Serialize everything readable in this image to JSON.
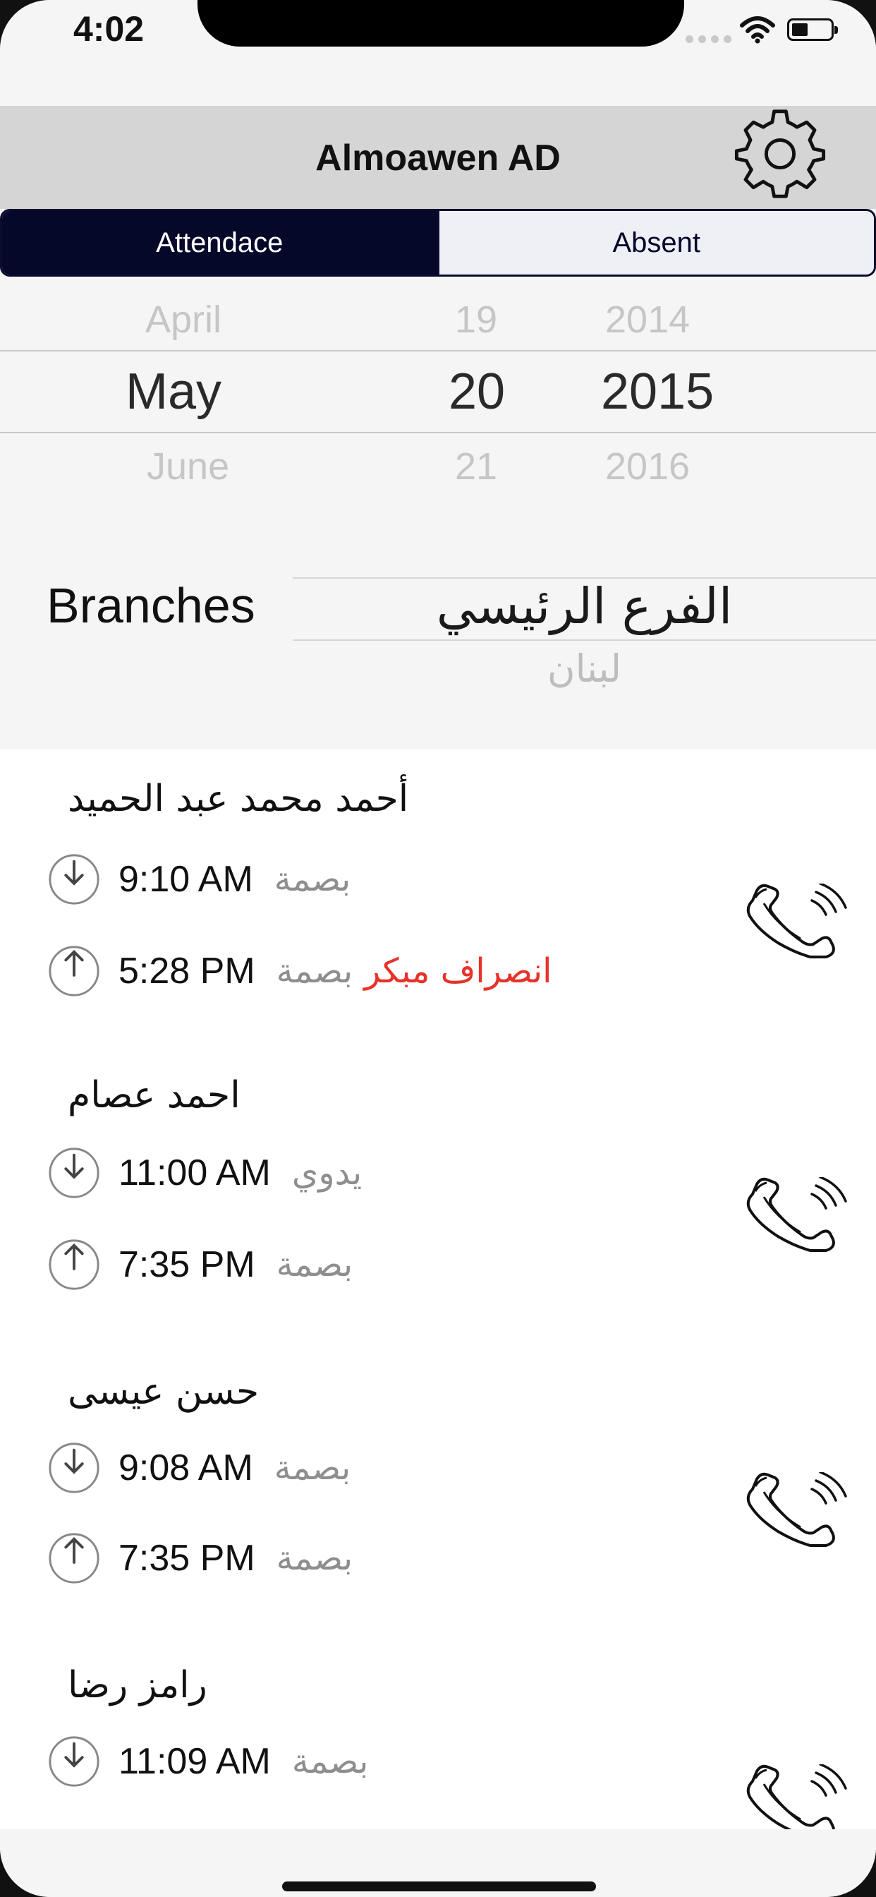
{
  "status_bar": {
    "time": "4:02"
  },
  "header": {
    "title": "Almoawen AD"
  },
  "tabs": {
    "attendance_label": "Attendace",
    "absent_label": "Absent"
  },
  "date_picker": {
    "month": {
      "prev": "April",
      "selected": "May",
      "next": "June"
    },
    "day": {
      "prev": "19",
      "selected": "20",
      "next": "21"
    },
    "year": {
      "prev": "2014",
      "selected": "2015",
      "next": "2016"
    }
  },
  "branches": {
    "label": "Branches",
    "selected": "الفرع الرئيسي",
    "next": "لبنان"
  },
  "employees": [
    {
      "name": "أحمد  محمد عبد الحميد",
      "check_in": {
        "time": "9:10 AM",
        "method": "بصمة"
      },
      "check_out": {
        "time": "5:28 PM",
        "method": "بصمة",
        "flag": "انصراف مبكر"
      }
    },
    {
      "name": "احمد عصام",
      "check_in": {
        "time": "11:00 AM",
        "method": "يدوي"
      },
      "check_out": {
        "time": "7:35 PM",
        "method": "بصمة"
      }
    },
    {
      "name": "حسن عيسى",
      "check_in": {
        "time": "9:08 AM",
        "method": "بصمة"
      },
      "check_out": {
        "time": "7:35 PM",
        "method": "بصمة"
      }
    },
    {
      "name": "رامز رضا",
      "check_in": {
        "time": "11:09 AM",
        "method": "بصمة"
      }
    }
  ],
  "icons": {
    "settings": "gear-icon",
    "check_in": "arrow-down-circle-icon",
    "check_out": "arrow-up-circle-icon",
    "call": "phone-icon"
  },
  "colors": {
    "segment_active": "#050829",
    "late_flag": "#e8322a",
    "nav_background": "#d5d5d5"
  }
}
